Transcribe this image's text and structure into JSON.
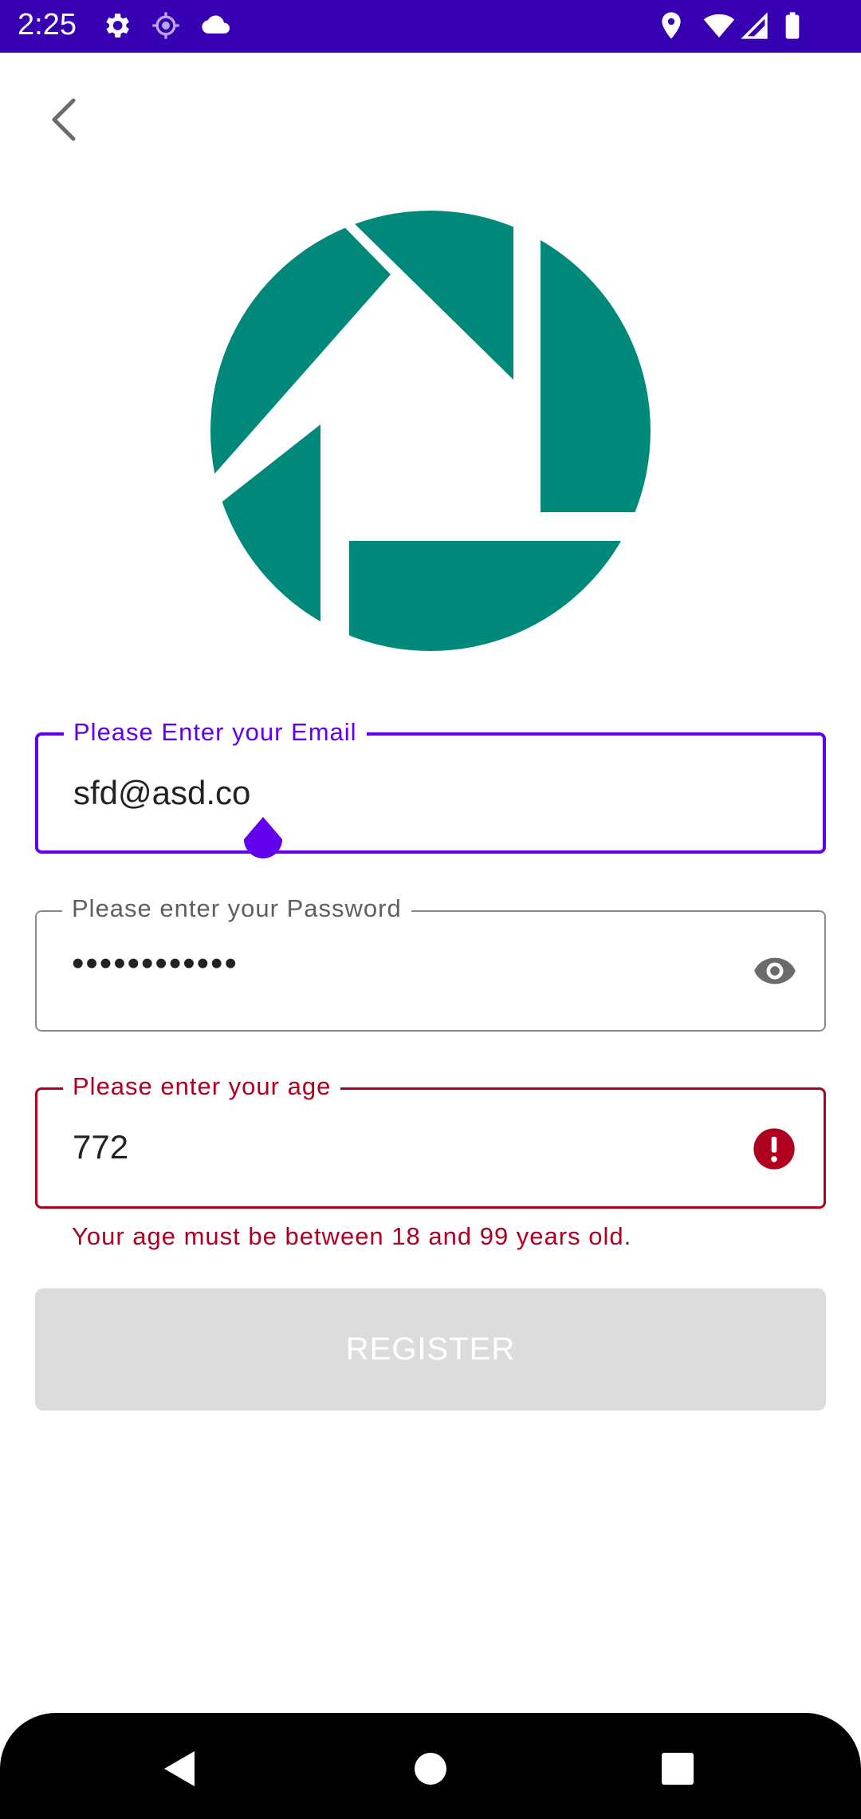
{
  "status_bar": {
    "time": "2:25",
    "left_icons": [
      "gear-icon",
      "location-target-icon",
      "cloud-icon"
    ],
    "right_icons": [
      "location-pin-icon",
      "wifi-icon",
      "signal-icon",
      "battery-icon"
    ],
    "color": "#3700B3"
  },
  "header": {
    "back_icon": "chevron-left-icon"
  },
  "logo": {
    "icon": "aperture-logo-icon",
    "color": "#00897B"
  },
  "form": {
    "email": {
      "label": "Please Enter your Email",
      "value": "sfd@asd.co",
      "focused": true,
      "accent": "#6200EE"
    },
    "password": {
      "label": "Please enter your Password",
      "value": "••••••••••••",
      "trailing_icon": "eye-icon"
    },
    "age": {
      "label": "Please enter your age",
      "value": "772",
      "trailing_icon": "error-icon",
      "error": "Your age must be between 18 and 99 years old.",
      "error_color": "#B00020"
    },
    "register_button": {
      "label": "REGISTER",
      "enabled": false
    }
  },
  "nav_bar": {
    "icons": [
      "back-triangle-icon",
      "home-circle-icon",
      "recents-square-icon"
    ]
  }
}
